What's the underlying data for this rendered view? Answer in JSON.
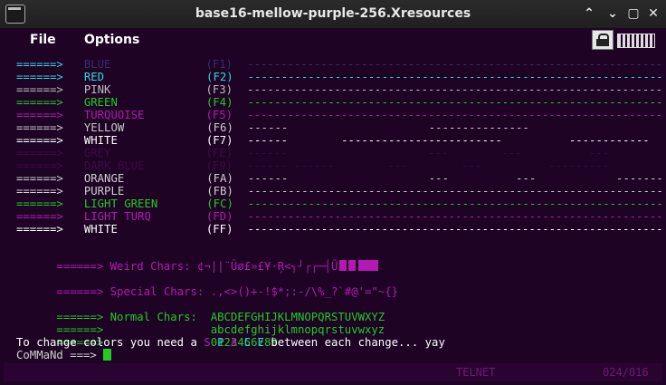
{
  "window": {
    "title": "base16-mellow-purple-256.Xresources"
  },
  "titlebar_buttons": [
    "⌃",
    "⌄",
    "▢",
    "✕"
  ],
  "menubar": {
    "file": "File",
    "options": "Options"
  },
  "colors": {
    "bg": "#1e0325",
    "white": "#ffffff",
    "blue_faint": "#3b2a6e",
    "red": "#2dd8e0",
    "pink": "#bdbdbd",
    "green": "#1fcc1f",
    "turquoise": "#b31ab3",
    "yellow": "#c9c9c9",
    "grey_faint": "#3c0a42",
    "darkblue_faint": "#3c0a42",
    "orange": "#cfcfcf",
    "purple": "#cfcfcf",
    "lightgreen": "#1fcc1f",
    "lightturq": "#b31ab3"
  },
  "color_rows": [
    {
      "arrow": "======>",
      "name": "BLUE",
      "key": "(F1)",
      "dashes": "------------------------------------------------------------------------------------------------------------",
      "arrow_color": "#2dd8e0",
      "color": "#3b2a6e",
      "key_color": "#3b2a6e"
    },
    {
      "arrow": "======>",
      "name": "RED",
      "key": "(F2)",
      "dashes": "------------------------------------------------------------------------------------------------------------",
      "arrow_color": "#2dd8e0",
      "color": "#2dd8e0",
      "key_color": "#2dd8e0"
    },
    {
      "arrow": "======>",
      "name": "PINK",
      "key": "(F3)",
      "dashes": "------------------------------------------------------------------------------------------------------------",
      "arrow_color": "#bdbdbd",
      "color": "#bdbdbd",
      "key_color": "#bdbdbd"
    },
    {
      "arrow": "======>",
      "name": "GREEN",
      "key": "(F4)",
      "dashes": "------------------------------------------------------------------------------------------------------------",
      "arrow_color": "#1fcc1f",
      "color": "#1fcc1f",
      "key_color": "#1fcc1f"
    },
    {
      "arrow": "======>",
      "name": "TURQUOISE",
      "key": "(F5)",
      "dashes": "------------------------------------------------------------------------------------------------------------",
      "arrow_color": "#b31ab3",
      "color": "#b31ab3",
      "key_color": "#b31ab3"
    },
    {
      "arrow": "======>",
      "name": "YELLOW",
      "key": "(F6)",
      "dashes": "------                     ---------------                     ---",
      "arrow_color": "#c9c9c9",
      "color": "#c9c9c9",
      "key_color": "#c9c9c9"
    },
    {
      "arrow": "======>",
      "name": "WHITE",
      "key": "(F7)",
      "dashes": "------        ------------------------          ------------",
      "arrow_color": "#ffffff",
      "color": "#ffffff",
      "key_color": "#ffffff"
    },
    {
      "arrow": "======>",
      "name": "GREY",
      "key": "(FE)",
      "dashes": "------                     ---        ---          ---",
      "arrow_color": "#3c0a42",
      "color": "#3c0a42",
      "key_color": "#3c0a42"
    },
    {
      "arrow": "======>",
      "name": "DARK BLUE",
      "key": "(F9)",
      "dashes": "------ ------        ---        ---          ---------",
      "arrow_color": "#3c0a42",
      "color": "#3c0a42",
      "key_color": "#3c0a42"
    },
    {
      "arrow": "======>",
      "name": "ORANGE",
      "key": "(FA)",
      "dashes": "------                     ---          ---            ---------",
      "arrow_color": "#cfcfcf",
      "color": "#cfcfcf",
      "key_color": "#cfcfcf"
    },
    {
      "arrow": "======>",
      "name": "PURPLE",
      "key": "(FB)",
      "dashes": "------------------------------------------------------------------------------------------------------------",
      "arrow_color": "#cfcfcf",
      "color": "#cfcfcf",
      "key_color": "#cfcfcf"
    },
    {
      "arrow": "======>",
      "name": "LIGHT GREEN",
      "key": "(FC)",
      "dashes": "------------------------------------------------------------------------------------------------------------",
      "arrow_color": "#1fcc1f",
      "color": "#1fcc1f",
      "key_color": "#1fcc1f"
    },
    {
      "arrow": "======>",
      "name": "LIGHT TURQ",
      "key": "(FD)",
      "dashes": "------------------------------------------------------------------------------------------------------------",
      "arrow_color": "#b31ab3",
      "color": "#b31ab3",
      "key_color": "#b31ab3"
    },
    {
      "arrow": "======>",
      "name": "WHITE",
      "key": "(FF)",
      "dashes": "------------------------------------------------------------------------------------------------------------",
      "arrow_color": "#ffffff",
      "color": "#ffffff",
      "key_color": "#ffffff"
    }
  ],
  "weird": {
    "arrow": "======>",
    "label": "Weird Chars:",
    "chars": "¢¬||¨Ûø£»£¥·Ŗ<┐┘┌┌─┤Ū",
    "color": "#b31ab3"
  },
  "special": {
    "arrow": "======>",
    "label": "Special Chars:",
    "chars": ".,<>()+-!$*;:-/\\%_?`#@'=\"~{}",
    "color": "#b31ab3"
  },
  "normal": {
    "arrow": "======>",
    "label": "Normal Chars:",
    "upper": "ABCDEFGHIJKLMNOPQRSTUVWXYZ",
    "lower": "abcdefghijklmnopqrstuvwxyz",
    "digits": "0123456789",
    "color": "#1fcc1f"
  },
  "change_msg": {
    "pre": "To change colors you need a ",
    "s": "S",
    "p": "P",
    "a": "A",
    "c": "C",
    "e": "E",
    "post": " between each change... yay"
  },
  "prompt": {
    "text": "CoMMaNd ===>"
  },
  "status": {
    "mode": "TELNET",
    "position": "024/016"
  }
}
